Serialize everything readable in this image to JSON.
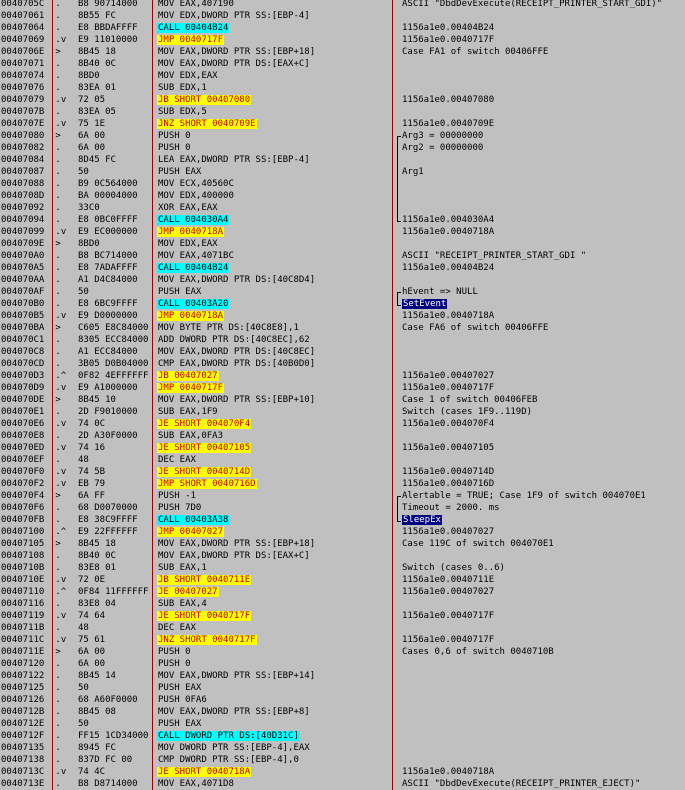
{
  "rows": [
    {
      "addr": "0040705C",
      "mk": " .",
      "hex": "B8 90714000",
      "dis": "MOV EAX,407190",
      "hl": "",
      "com": "ASCII \"DbdDevExecute(RECEIPT_PRINTER_START_GDI)\""
    },
    {
      "addr": "00407061",
      "mk": " .",
      "hex": "8B55 FC",
      "dis": "MOV EDX,DWORD PTR SS:[EBP-4]",
      "hl": "",
      "com": ""
    },
    {
      "addr": "00407064",
      "mk": " .",
      "hex": "E8 BBDAFFFF",
      "dis": "CALL 00404B24",
      "hl": "cyan",
      "com": "1156a1e0.00404B24"
    },
    {
      "addr": "00407069",
      "mk": " .v",
      "hex": "E9 11010000",
      "dis": "JMP 0040717F",
      "hl": "yellow",
      "com": "1156a1e0.0040717F"
    },
    {
      "addr": "0040706E",
      "mk": " >",
      "hex": "8B45 18",
      "dis": "MOV EAX,DWORD PTR SS:[EBP+18]",
      "hl": "",
      "com": "Case FA1 of switch 00406FFE"
    },
    {
      "addr": "00407071",
      "mk": " .",
      "hex": "8B40 0C",
      "dis": "MOV EAX,DWORD PTR DS:[EAX+C]",
      "hl": "",
      "com": ""
    },
    {
      "addr": "00407074",
      "mk": " .",
      "hex": "8BD0",
      "dis": "MOV EDX,EAX",
      "hl": "",
      "com": ""
    },
    {
      "addr": "00407076",
      "mk": " .",
      "hex": "83EA 01",
      "dis": "SUB EDX,1",
      "hl": "",
      "com": ""
    },
    {
      "addr": "00407079",
      "mk": " .v",
      "hex": "72 05",
      "dis": "JB SHORT 00407080",
      "hl": "yellow",
      "com": "1156a1e0.00407080"
    },
    {
      "addr": "0040707B",
      "mk": " .",
      "hex": "83EA 05",
      "dis": "SUB EDX,5",
      "hl": "",
      "com": ""
    },
    {
      "addr": "0040707E",
      "mk": " .v",
      "hex": "75 1E",
      "dis": "JNZ SHORT 0040709E",
      "hl": "yellow",
      "com": "1156a1e0.0040709E"
    },
    {
      "addr": "00407080",
      "mk": " >",
      "hex": "6A 00",
      "dis": "PUSH 0",
      "hl": "",
      "com": "Arg3 = 00000000"
    },
    {
      "addr": "00407082",
      "mk": " .",
      "hex": "6A 00",
      "dis": "PUSH 0",
      "hl": "",
      "com": "Arg2 = 00000000"
    },
    {
      "addr": "00407084",
      "mk": " .",
      "hex": "8D45 FC",
      "dis": "LEA EAX,DWORD PTR SS:[EBP-4]",
      "hl": "",
      "com": ""
    },
    {
      "addr": "00407087",
      "mk": " .",
      "hex": "50",
      "dis": "PUSH EAX",
      "hl": "",
      "com": "Arg1"
    },
    {
      "addr": "00407088",
      "mk": " .",
      "hex": "B9 0C564000",
      "dis": "MOV ECX,40560C",
      "hl": "",
      "com": ""
    },
    {
      "addr": "0040708D",
      "mk": " .",
      "hex": "BA 00004000",
      "dis": "MOV EDX,400000",
      "hl": "",
      "com": ""
    },
    {
      "addr": "00407092",
      "mk": " .",
      "hex": "33C0",
      "dis": "XOR EAX,EAX",
      "hl": "",
      "com": ""
    },
    {
      "addr": "00407094",
      "mk": " .",
      "hex": "E8 0BC0FFFF",
      "dis": "CALL 004030A4",
      "hl": "cyan",
      "com": "1156a1e0.004030A4"
    },
    {
      "addr": "00407099",
      "mk": " .v",
      "hex": "E9 EC000000",
      "dis": "JMP 0040718A",
      "hl": "yellow",
      "com": "1156a1e0.0040718A"
    },
    {
      "addr": "0040709E",
      "mk": " >",
      "hex": "8BD0",
      "dis": "MOV EDX,EAX",
      "hl": "",
      "com": ""
    },
    {
      "addr": "004070A0",
      "mk": " .",
      "hex": "B8 BC714000",
      "dis": "MOV EAX,4071BC",
      "hl": "",
      "com": "ASCII \"RECEIPT_PRINTER_START_GDI \""
    },
    {
      "addr": "004070A5",
      "mk": " .",
      "hex": "E8 7ADAFFFF",
      "dis": "CALL 00404B24",
      "hl": "cyan",
      "com": "1156a1e0.00404B24"
    },
    {
      "addr": "004070AA",
      "mk": " .",
      "hex": "A1 D4C84000",
      "dis": "MOV EAX,DWORD PTR DS:[40C8D4]",
      "hl": "",
      "com": ""
    },
    {
      "addr": "004070AF",
      "mk": " .",
      "hex": "50",
      "dis": "PUSH EAX",
      "hl": "",
      "com": "hEvent => NULL"
    },
    {
      "addr": "004070B0",
      "mk": " .",
      "hex": "E8 6BC9FFFF",
      "dis": "CALL 00403A20",
      "hl": "cyan",
      "com": "SetEvent"
    },
    {
      "addr": "004070B5",
      "mk": " .v",
      "hex": "E9 D0000000",
      "dis": "JMP 0040718A",
      "hl": "yellow",
      "com": "1156a1e0.0040718A"
    },
    {
      "addr": "004070BA",
      "mk": " >",
      "hex": "C605 E8C84000",
      "dis": "MOV BYTE PTR DS:[40C8E8],1",
      "hl": "",
      "com": "Case FA6 of switch 00406FFE"
    },
    {
      "addr": "004070C1",
      "mk": " .",
      "hex": "8305 ECC84000",
      "dis": "ADD DWORD PTR DS:[40C8EC],62",
      "hl": "",
      "com": ""
    },
    {
      "addr": "004070C8",
      "mk": " .",
      "hex": "A1 ECC84000",
      "dis": "MOV EAX,DWORD PTR DS:[40C8EC]",
      "hl": "",
      "com": ""
    },
    {
      "addr": "004070CD",
      "mk": " .",
      "hex": "3B05 D0B04000",
      "dis": "CMP EAX,DWORD PTR DS:[40B0D0]",
      "hl": "",
      "com": ""
    },
    {
      "addr": "004070D3",
      "mk": " .^",
      "hex": "0F82 4EFFFFFF",
      "dis": "JB 00407027",
      "hl": "yellow",
      "com": "1156a1e0.00407027"
    },
    {
      "addr": "004070D9",
      "mk": " .v",
      "hex": "E9 A1000000",
      "dis": "JMP 0040717F",
      "hl": "yellow",
      "com": "1156a1e0.0040717F"
    },
    {
      "addr": "004070DE",
      "mk": " >",
      "hex": "8B45 10",
      "dis": "MOV EAX,DWORD PTR SS:[EBP+10]",
      "hl": "",
      "com": "Case 1 of switch 00406FEB"
    },
    {
      "addr": "004070E1",
      "mk": " .",
      "hex": "2D F9010000",
      "dis": "SUB EAX,1F9",
      "hl": "",
      "com": "Switch (cases 1F9..119D)"
    },
    {
      "addr": "004070E6",
      "mk": " .v",
      "hex": "74 0C",
      "dis": "JE SHORT 004070F4",
      "hl": "yellow",
      "com": "1156a1e0.004070F4"
    },
    {
      "addr": "004070E8",
      "mk": " .",
      "hex": "2D A30F0000",
      "dis": "SUB EAX,0FA3",
      "hl": "",
      "com": ""
    },
    {
      "addr": "004070ED",
      "mk": " .v",
      "hex": "74 16",
      "dis": "JE SHORT 00407105",
      "hl": "yellow",
      "com": "1156a1e0.00407105"
    },
    {
      "addr": "004070EF",
      "mk": " .",
      "hex": "48",
      "dis": "DEC EAX",
      "hl": "",
      "com": ""
    },
    {
      "addr": "004070F0",
      "mk": " .v",
      "hex": "74 5B",
      "dis": "JE SHORT 0040714D",
      "hl": "yellow",
      "com": "1156a1e0.0040714D"
    },
    {
      "addr": "004070F2",
      "mk": " .v",
      "hex": "EB 79",
      "dis": "JMP SHORT 0040716D",
      "hl": "yellow",
      "com": "1156a1e0.0040716D"
    },
    {
      "addr": "004070F4",
      "mk": " >",
      "hex": "6A FF",
      "dis": "PUSH -1",
      "hl": "",
      "com": "Alertable = TRUE; Case 1F9 of switch 004070E1"
    },
    {
      "addr": "004070F6",
      "mk": " .",
      "hex": "68 D0070000",
      "dis": "PUSH 7D0",
      "hl": "",
      "com": "Timeout = 2000. ms"
    },
    {
      "addr": "004070FB",
      "mk": " .",
      "hex": "E8 38C9FFFF",
      "dis": "CALL 00403A38",
      "hl": "cyan",
      "com": "SleepEx"
    },
    {
      "addr": "00407100",
      "mk": " .^",
      "hex": "E9 22FFFFFF",
      "dis": "JMP 00407027",
      "hl": "yellow",
      "com": "1156a1e0.00407027"
    },
    {
      "addr": "00407105",
      "mk": " >",
      "hex": "8B45 18",
      "dis": "MOV EAX,DWORD PTR SS:[EBP+18]",
      "hl": "",
      "com": "Case 119C of switch 004070E1"
    },
    {
      "addr": "00407108",
      "mk": " .",
      "hex": "8B40 0C",
      "dis": "MOV EAX,DWORD PTR DS:[EAX+C]",
      "hl": "",
      "com": ""
    },
    {
      "addr": "0040710B",
      "mk": " .",
      "hex": "83E8 01",
      "dis": "SUB EAX,1",
      "hl": "",
      "com": "Switch (cases 0..6)"
    },
    {
      "addr": "0040710E",
      "mk": " .v",
      "hex": "72 0E",
      "dis": "JB SHORT 0040711E",
      "hl": "yellow",
      "com": "1156a1e0.0040711E"
    },
    {
      "addr": "00407110",
      "mk": " .^",
      "hex": "0F84 11FFFFFF",
      "dis": "JE 00407027",
      "hl": "yellow",
      "com": "1156a1e0.00407027"
    },
    {
      "addr": "00407116",
      "mk": " .",
      "hex": "83E8 04",
      "dis": "SUB EAX,4",
      "hl": "",
      "com": ""
    },
    {
      "addr": "00407119",
      "mk": " .v",
      "hex": "74 64",
      "dis": "JE SHORT 0040717F",
      "hl": "yellow",
      "com": "1156a1e0.0040717F"
    },
    {
      "addr": "0040711B",
      "mk": " .",
      "hex": "48",
      "dis": "DEC EAX",
      "hl": "",
      "com": ""
    },
    {
      "addr": "0040711C",
      "mk": " .v",
      "hex": "75 61",
      "dis": "JNZ SHORT 0040717F",
      "hl": "yellow",
      "com": "1156a1e0.0040717F"
    },
    {
      "addr": "0040711E",
      "mk": " >",
      "hex": "6A 00",
      "dis": "PUSH 0",
      "hl": "",
      "com": "Cases 0,6 of switch 0040710B"
    },
    {
      "addr": "00407120",
      "mk": " .",
      "hex": "6A 00",
      "dis": "PUSH 0",
      "hl": "",
      "com": ""
    },
    {
      "addr": "00407122",
      "mk": " .",
      "hex": "8B45 14",
      "dis": "MOV EAX,DWORD PTR SS:[EBP+14]",
      "hl": "",
      "com": ""
    },
    {
      "addr": "00407125",
      "mk": " .",
      "hex": "50",
      "dis": "PUSH EAX",
      "hl": "",
      "com": ""
    },
    {
      "addr": "00407126",
      "mk": " .",
      "hex": "68 A60F0000",
      "dis": "PUSH 0FA6",
      "hl": "",
      "com": ""
    },
    {
      "addr": "0040712B",
      "mk": " .",
      "hex": "8B45 08",
      "dis": "MOV EAX,DWORD PTR SS:[EBP+8]",
      "hl": "",
      "com": ""
    },
    {
      "addr": "0040712E",
      "mk": " .",
      "hex": "50",
      "dis": "PUSH EAX",
      "hl": "",
      "com": ""
    },
    {
      "addr": "0040712F",
      "mk": " .",
      "hex": "FF15 1CD34000",
      "dis": "CALL DWORD PTR DS:[40D31C]",
      "hl": "cyan",
      "com": ""
    },
    {
      "addr": "00407135",
      "mk": " .",
      "hex": "8945 FC",
      "dis": "MOV DWORD PTR SS:[EBP-4],EAX",
      "hl": "",
      "com": ""
    },
    {
      "addr": "00407138",
      "mk": " .",
      "hex": "837D FC 00",
      "dis": "CMP DWORD PTR SS:[EBP-4],0",
      "hl": "",
      "com": ""
    },
    {
      "addr": "0040713C",
      "mk": " .v",
      "hex": "74 4C",
      "dis": "JE SHORT 0040718A",
      "hl": "yellow",
      "com": "1156a1e0.0040718A"
    },
    {
      "addr": "0040713E",
      "mk": " .",
      "hex": "B8 D8714000",
      "dis": "MOV EAX,4071D8",
      "hl": "",
      "com": "ASCII \"DbdDevExecute(RECEIPT_PRINTER_EJECT)\""
    }
  ]
}
